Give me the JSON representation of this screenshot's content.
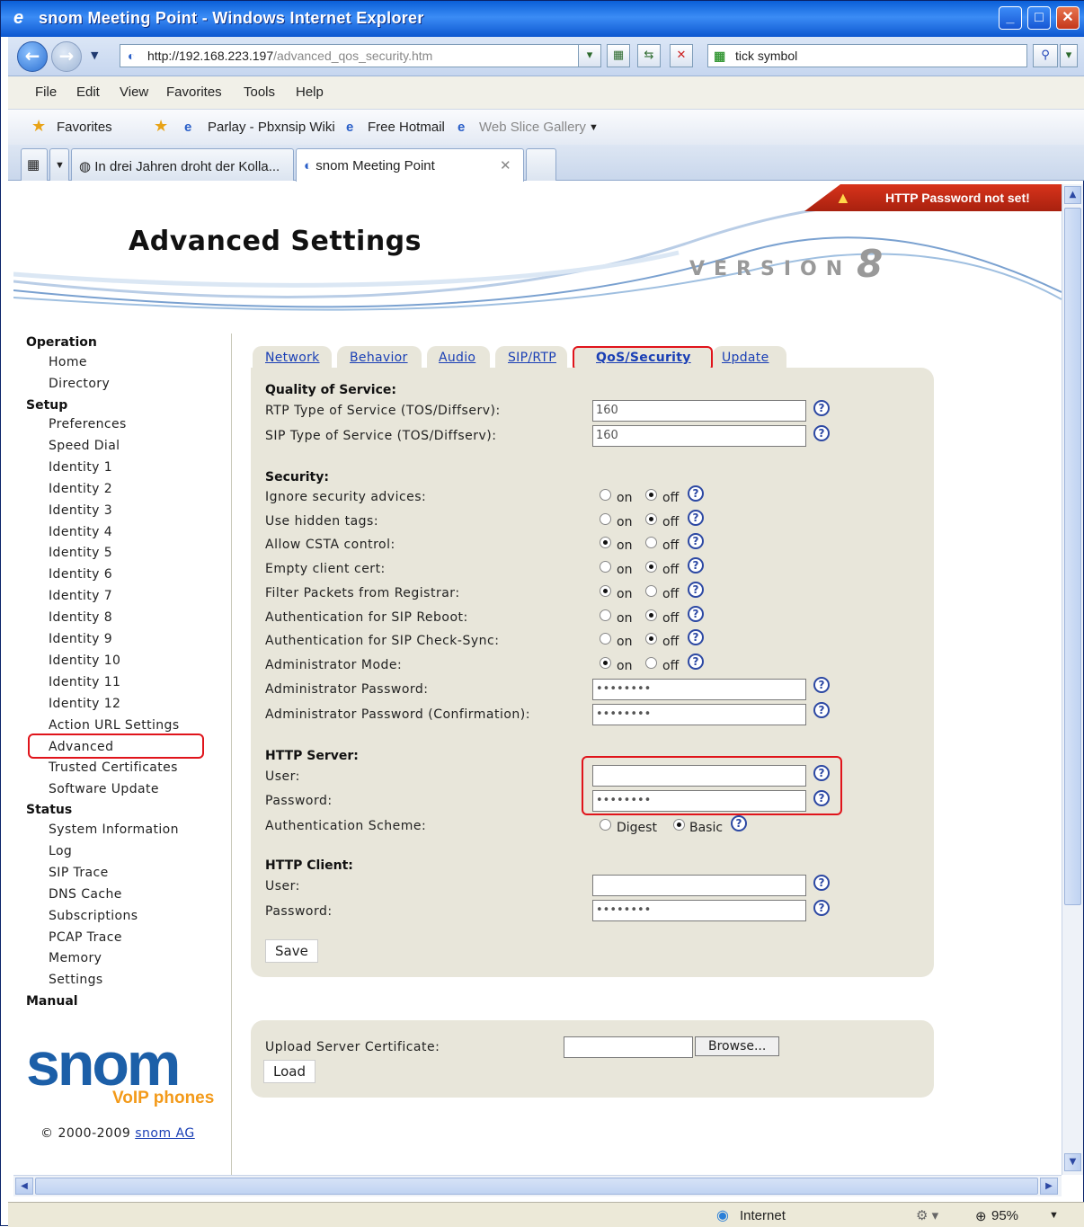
{
  "window": {
    "title": "snom Meeting Point - Windows Internet Explorer"
  },
  "browser": {
    "url_host": "http://192.168.223.197",
    "url_path": "/advanced_qos_security.htm",
    "search_value": "tick symbol",
    "menu": [
      "File",
      "Edit",
      "View",
      "Favorites",
      "Tools",
      "Help"
    ],
    "favorites_label": "Favorites",
    "fav_links": [
      "Parlay - Pbxnsip Wiki",
      "Free Hotmail",
      "Web Slice Gallery"
    ],
    "tabs": [
      "In drei Jahren droht der Kolla...",
      "snom Meeting Point"
    ],
    "status_zone": "Internet",
    "zoom": "95%"
  },
  "page": {
    "warning": "HTTP Password not set!",
    "title": "Advanced Settings",
    "version_word": "VERSION",
    "version_num": "8"
  },
  "nav": {
    "operation": "Operation",
    "operation_items": [
      "Home",
      "Directory"
    ],
    "setup": "Setup",
    "setup_items": [
      "Preferences",
      "Speed Dial",
      "Identity 1",
      "Identity 2",
      "Identity 3",
      "Identity 4",
      "Identity 5",
      "Identity 6",
      "Identity 7",
      "Identity 8",
      "Identity 9",
      "Identity 10",
      "Identity 11",
      "Identity 12",
      "Action URL Settings",
      "Advanced",
      "Trusted Certificates",
      "Software Update"
    ],
    "status": "Status",
    "status_items": [
      "System Information",
      "Log",
      "SIP Trace",
      "DNS Cache",
      "Subscriptions",
      "PCAP Trace",
      "Memory",
      "Settings"
    ],
    "manual": "Manual",
    "logo_text": "snom",
    "logo_sub": "VoIP phones",
    "copyright": "© 2000-2009",
    "copyright_link": "snom AG"
  },
  "tabs": [
    "Network",
    "Behavior",
    "Audio",
    "SIP/RTP",
    "QoS/Security",
    "Update"
  ],
  "form": {
    "qos_heading": "Quality of Service:",
    "rtp_tos_label": "RTP Type of Service (TOS/Diffserv):",
    "rtp_tos_value": "160",
    "sip_tos_label": "SIP Type of Service (TOS/Diffserv):",
    "sip_tos_value": "160",
    "security_heading": "Security:",
    "on_label": "on",
    "off_label": "off",
    "toggles": [
      {
        "label": "Ignore security advices:",
        "value": "off"
      },
      {
        "label": "Use hidden tags:",
        "value": "off"
      },
      {
        "label": "Allow CSTA control:",
        "value": "on"
      },
      {
        "label": "Empty client cert:",
        "value": "off"
      },
      {
        "label": "Filter Packets from Registrar:",
        "value": "on"
      },
      {
        "label": "Authentication for SIP Reboot:",
        "value": "off"
      },
      {
        "label": "Authentication for SIP Check-Sync:",
        "value": "off"
      },
      {
        "label": "Administrator Mode:",
        "value": "on"
      }
    ],
    "admin_pw_label": "Administrator Password:",
    "admin_pw_value": "••••••••",
    "admin_pw_confirm_label": "Administrator Password (Confirmation):",
    "admin_pw_confirm_value": "••••••••",
    "http_server_heading": "HTTP Server:",
    "http_server_user_label": "User:",
    "http_server_user_value": "",
    "http_server_pw_label": "Password:",
    "http_server_pw_value": "••••••••",
    "auth_scheme_label": "Authentication Scheme:",
    "auth_digest": "Digest",
    "auth_basic": "Basic",
    "auth_selected": "Basic",
    "http_client_heading": "HTTP Client:",
    "http_client_user_label": "User:",
    "http_client_user_value": "",
    "http_client_pw_label": "Password:",
    "http_client_pw_value": "••••••••",
    "save_label": "Save",
    "upload_label": "Upload Server Certificate:",
    "browse_label": "Browse...",
    "load_label": "Load"
  }
}
